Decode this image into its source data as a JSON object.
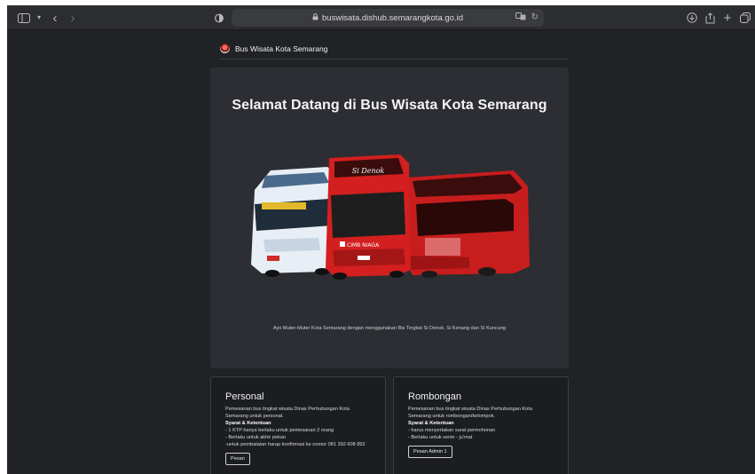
{
  "browser": {
    "url": "buswisata.dishub.semarangkota.go.id"
  },
  "navbar": {
    "brand": "Bus Wisata Kota Semarang"
  },
  "hero": {
    "title": "Selamat Datang di Bus Wisata Kota Semarang",
    "caption": "Ayo Muter-Muter Kota Semarang dengan menggunakan Bis Tingkat Si Denok, Si Kenang dan Si Kuncung",
    "bus_labels": {
      "bus2_destination": "Si Denok",
      "bus2_sponsor": "CIMB NIAGA"
    }
  },
  "cards": {
    "personal": {
      "title": "Personal",
      "desc": "Pemesanan bus tingkat wisata Dinas Perhubungan Kota Semarang untuk personal.",
      "terms_heading": "Syarat & Ketentuan",
      "terms": [
        "- 1 KTP hanya berlaku untuk pemesanan 2 orang",
        "- Berlaku untuk akhir pekan",
        "-untuk pembatalan harap konfirmasi ke nomor 081 392 608 892"
      ],
      "button": "Pesan"
    },
    "group": {
      "title": "Rombongan",
      "desc": "Pemesanan bus tingkat wisata Dinas Perhubungan Kota Semarang untuk rombongan/kelompok.",
      "terms_heading": "Syarat & Ketentuan",
      "terms": [
        "- harus menyertakan surat permohonan",
        "- Berlaku untuk senin - ju'mat"
      ],
      "button": "Pesan Admin 1"
    }
  },
  "colors": {
    "page_bg": "#202226",
    "hero_bg": "#2c2e33",
    "bus_red": "#d31f1f",
    "bus_white": "#e8eef5"
  }
}
